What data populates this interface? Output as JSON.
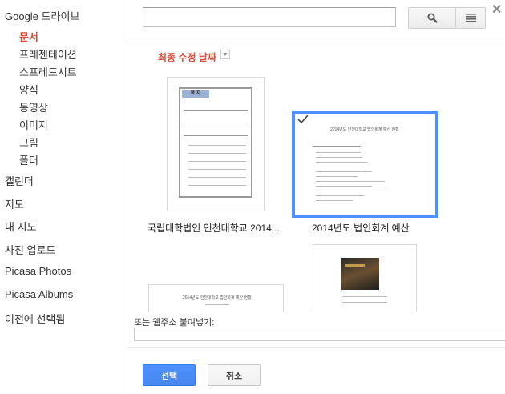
{
  "sidebar": {
    "items": [
      {
        "label": "Google 드라이브"
      },
      {
        "label": "문서"
      },
      {
        "label": "프레젠테이션"
      },
      {
        "label": "스프레드시트"
      },
      {
        "label": "양식"
      },
      {
        "label": "동영상"
      },
      {
        "label": "이미지"
      },
      {
        "label": "그림"
      },
      {
        "label": "폴더"
      },
      {
        "label": "캘린더"
      },
      {
        "label": "지도"
      },
      {
        "label": "내 지도"
      },
      {
        "label": "사진 업로드"
      },
      {
        "label": "Picasa Photos"
      },
      {
        "label": "Picasa Albums"
      },
      {
        "label": "이전에 선택됨"
      }
    ]
  },
  "header": {
    "search_value": "",
    "close_glyph": "✕",
    "search_icon": "search-icon",
    "view_icon": "list-view-icon"
  },
  "sort": {
    "label": "최종 수정 날짜"
  },
  "files": [
    {
      "title": "국립대학법인 인천대학교 2014...",
      "selected": false,
      "preview": {
        "heading": "목 차"
      }
    },
    {
      "title": "2014년도 법인회계 예산",
      "selected": true,
      "preview": {
        "heading": "2014년도 인천대학교 법인회계 예산 현황"
      }
    },
    {
      "title": "",
      "preview": {
        "heading": "2014년도 인천대학교 법인회계 예산 현황"
      }
    },
    {
      "title": "",
      "preview": {
        "caption": "인천대학교 캠퍼스"
      }
    }
  ],
  "url": {
    "label": "또는 웹주소 붙여넣기:",
    "value": ""
  },
  "footer": {
    "select_label": "선택",
    "cancel_label": "취소"
  },
  "colors": {
    "accent": "#dd4b39",
    "selection": "#4d90fe",
    "primary_button": "#4d90fe"
  }
}
